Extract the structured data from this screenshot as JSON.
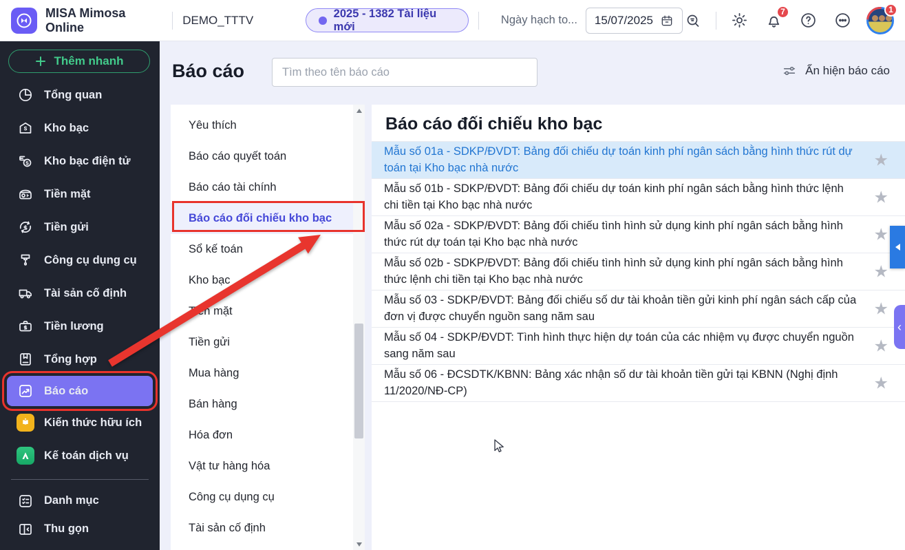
{
  "header": {
    "brand": "MISA Mimosa Online",
    "workspace": "DEMO_TTTV",
    "notification_pill": "2025 - 1382 Tài liệu mới",
    "posting_date_label": "Ngày hạch to...",
    "posting_date_value": "15/07/2025",
    "bell_badge": "7",
    "avatar_badge": "1"
  },
  "sidebar": {
    "quick_add_label": "Thêm nhanh",
    "items": [
      "Tổng quan",
      "Kho bạc",
      "Kho bạc điện tử",
      "Tiền mặt",
      "Tiền gửi",
      "Công cụ dụng cụ",
      "Tài sản cố định",
      "Tiền lương",
      "Tổng hợp",
      "Báo cáo",
      "Kiến thức hữu ích",
      "Kế toán dịch vụ"
    ],
    "active_item": "Báo cáo",
    "bottom_item": "Danh mục",
    "collapse_label": "Thu gọn"
  },
  "toolbar": {
    "page_title": "Báo cáo",
    "search_placeholder": "Tìm theo tên báo cáo",
    "toggle_label": "Ẩn hiện báo cáo"
  },
  "categories": {
    "selected": "Báo cáo đối chiếu kho bạc",
    "items": [
      "Yêu thích",
      "Báo cáo quyết toán",
      "Báo cáo tài chính",
      "Báo cáo đối chiếu kho bạc",
      "Sổ kế toán",
      "Kho bạc",
      "Tiền mặt",
      "Tiền gửi",
      "Mua hàng",
      "Bán hàng",
      "Hóa đơn",
      "Vật tư hàng hóa",
      "Công cụ dụng cụ",
      "Tài sản cố định"
    ]
  },
  "reports": {
    "title": "Báo cáo đối chiếu kho bạc",
    "selected_index": 0,
    "items": [
      "Mẫu số 01a - SDKP/ĐVDT: Bảng đối chiếu dự toán kinh phí ngân sách bằng hình thức rút dự toán tại Kho bạc nhà nước",
      "Mẫu số 01b - SDKP/ĐVDT: Bảng đối chiếu dự toán kinh phí ngân sách bằng hình thức lệnh chi tiền tại Kho bạc nhà nước",
      "Mẫu số 02a - SDKP/ĐVDT: Bảng đối chiếu tình hình sử dụng kinh phí ngân sách bằng hình thức rút dự toán tại Kho bạc nhà nước",
      "Mẫu số 02b - SDKP/ĐVDT: Bảng đối chiếu tình hình sử dụng kinh phí ngân sách bằng hình thức lệnh chi tiền tại Kho bạc nhà nước",
      "Mẫu số 03 - SDKP/ĐVDT: Bảng đối chiếu số dư tài khoản tiền gửi kinh phí ngân sách cấp của đơn vị được chuyển nguồn sang năm sau",
      "Mẫu số 04 - SDKP/ĐVDT: Tình hình thực hiện dự toán của các nhiệm vụ được chuyển nguồn sang năm sau",
      "Mẫu số 06 - ĐCSDTK/KBNN: Bảng xác nhận số dư tài khoản tiền gửi tại KBNN (Nghị định 11/2020/NĐ-CP)"
    ]
  },
  "icons": {
    "star": "★",
    "chevron_left": "‹"
  },
  "colors": {
    "accent_purple": "#7b73f2",
    "annotation_red": "#e8332c",
    "selected_row_bg": "#d8eafa",
    "link_blue": "#2276d2",
    "sidebar_bg": "#20242f",
    "quick_add_green": "#42cb8b",
    "pill_bg": "#eceafc"
  }
}
